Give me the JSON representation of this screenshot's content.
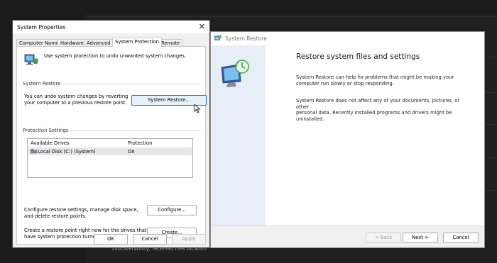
{
  "background": {
    "status_text": "Discoverability, received files location"
  },
  "system_properties": {
    "title": "System Properties",
    "close_glyph": "✕",
    "tabs": [
      {
        "label": "Computer Name"
      },
      {
        "label": "Hardware"
      },
      {
        "label": "Advanced"
      },
      {
        "label": "System Protection"
      },
      {
        "label": "Remote"
      }
    ],
    "active_tab": "System Protection",
    "intro": "Use system protection to undo unwanted system changes.",
    "restore_group": {
      "label": "System Restore",
      "text_line1": "You can undo system changes by reverting",
      "text_line2": "your computer to a previous restore point.",
      "button": "System Restore..."
    },
    "protection_group": {
      "label": "Protection Settings",
      "columns": [
        "Available Drives",
        "Protection"
      ],
      "drives": [
        {
          "name": "Local Disk (C:) (System)",
          "protection": "On",
          "icon": "drive-icon"
        }
      ],
      "configure_text_line1": "Configure restore settings, manage disk space,",
      "configure_text_line2": "and delete restore points.",
      "configure_button": "Configure...",
      "create_text_line1": "Create a restore point right now for the drives that",
      "create_text_line2": "have system protection turned on.",
      "create_button": "Create..."
    },
    "footer": {
      "ok": "OK",
      "cancel": "Cancel",
      "apply": "Apply"
    }
  },
  "system_restore": {
    "title": "System Restore",
    "heading": "Restore system files and settings",
    "para1_line1": "System Restore can help fix problems that might be making your",
    "para1_line2": "computer run slowly or stop responding.",
    "para2_line1": "System Restore does not affect any of your documents, pictures, or other",
    "para2_line2": "personal data. Recently installed programs and drivers might be",
    "para2_line3": "uninstalled.",
    "footer": {
      "back": "< Back",
      "next": "Next >",
      "cancel": "Cancel"
    }
  },
  "colors": {
    "accent": "#0078d7",
    "wizard_side_panel": "#e7eef8",
    "dialog_bg": "#f0f0f0"
  }
}
